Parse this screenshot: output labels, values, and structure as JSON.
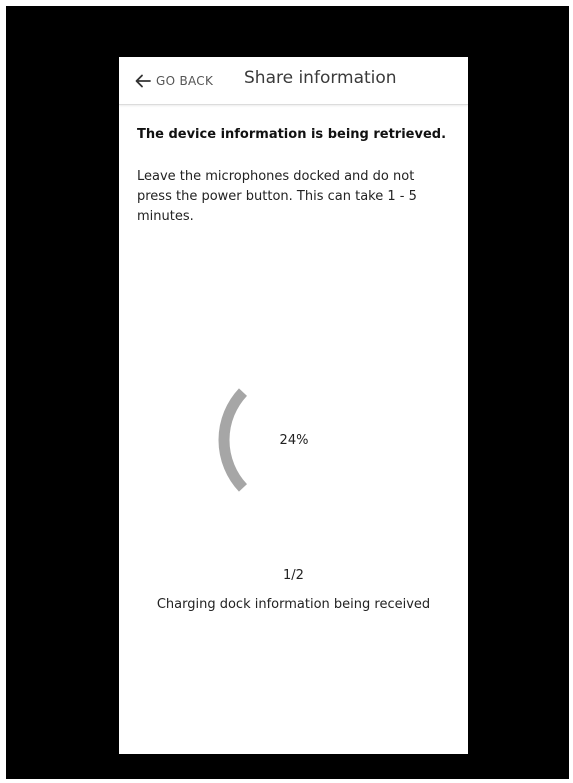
{
  "header": {
    "back_label": "GO BACK",
    "title": "Share information",
    "back_icon": "arrow-left-icon"
  },
  "content": {
    "heading": "The device information is being retrieved.",
    "description": "Leave the microphones docked and do not press the power button. This can take 1 - 5 minutes."
  },
  "progress": {
    "value": 0.24,
    "label": "24%",
    "arc_color": "#a6a6a6"
  },
  "step": {
    "label": "1/2",
    "status": "Charging dock information being received"
  },
  "colors": {
    "background": "#000000",
    "screen": "#ffffff",
    "text": "#222222"
  }
}
